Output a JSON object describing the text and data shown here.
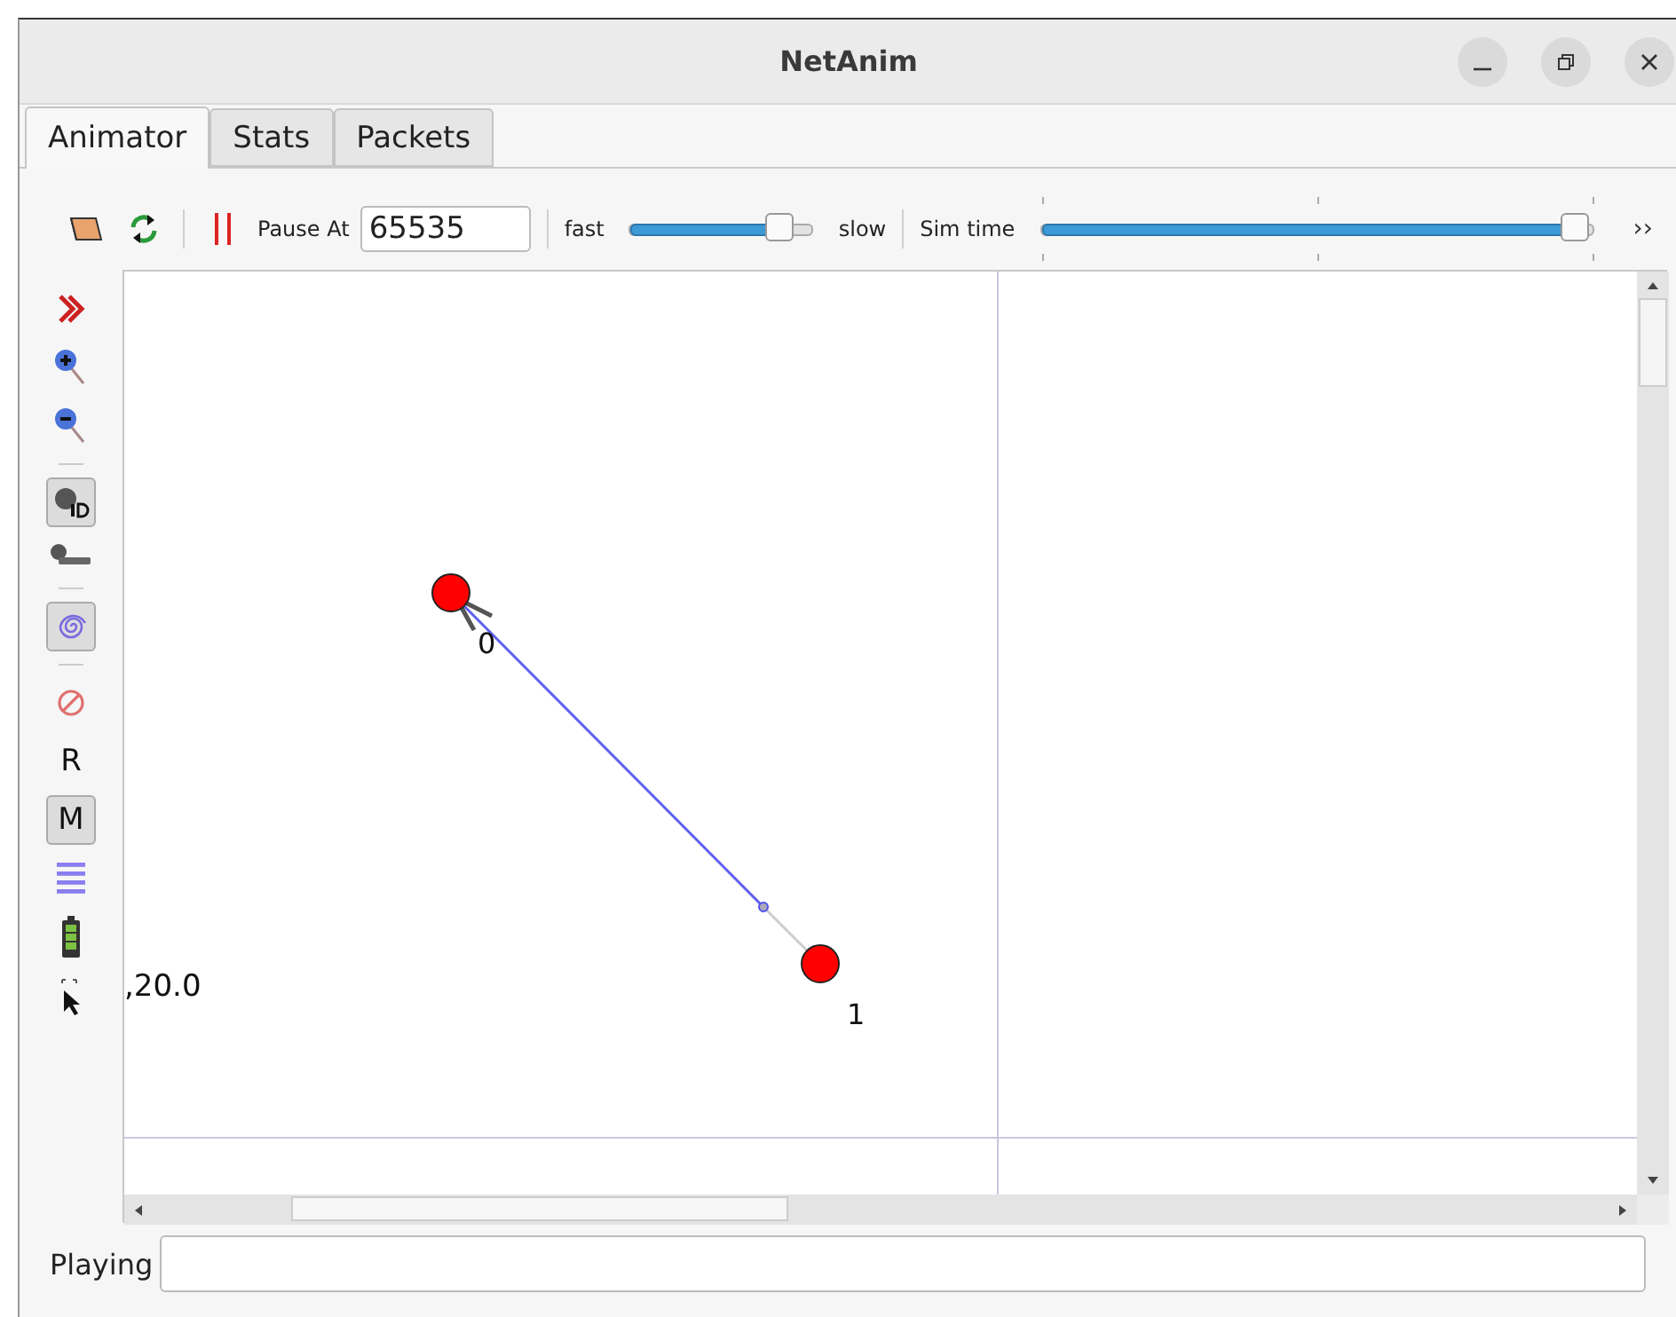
{
  "window": {
    "title": "NetAnim"
  },
  "tabs": [
    {
      "label": "Animator",
      "selected": true
    },
    {
      "label": "Stats",
      "selected": false
    },
    {
      "label": "Packets",
      "selected": false
    }
  ],
  "toolbar": {
    "pause_label": "Pause At",
    "pause_value": "65535",
    "speed": {
      "min_label": "fast",
      "max_label": "slow",
      "level": 0.82
    },
    "sim_time": {
      "label": "Sim time",
      "level": 0.97
    },
    "overflow": "››"
  },
  "sidebar": [
    {
      "kind": "expand"
    },
    {
      "kind": "zoom-in"
    },
    {
      "kind": "zoom-out"
    },
    {
      "kind": "separator"
    },
    {
      "kind": "node-id",
      "pressed": true
    },
    {
      "kind": "sys-id",
      "pressed": false
    },
    {
      "kind": "separator"
    },
    {
      "kind": "spiral",
      "pressed": true
    },
    {
      "kind": "separator"
    },
    {
      "kind": "stop"
    },
    {
      "kind": "text",
      "label": "R",
      "pressed": false
    },
    {
      "kind": "text",
      "label": "M",
      "pressed": true
    },
    {
      "kind": "lines"
    },
    {
      "kind": "battery"
    },
    {
      "kind": "pointer"
    }
  ],
  "canvas": {
    "coordinate": ",20.0",
    "nodes": [
      {
        "label": "0",
        "color": "#ff0000"
      },
      {
        "label": "1",
        "color": "#ff0000"
      }
    ]
  },
  "status": {
    "label": "Playing"
  }
}
